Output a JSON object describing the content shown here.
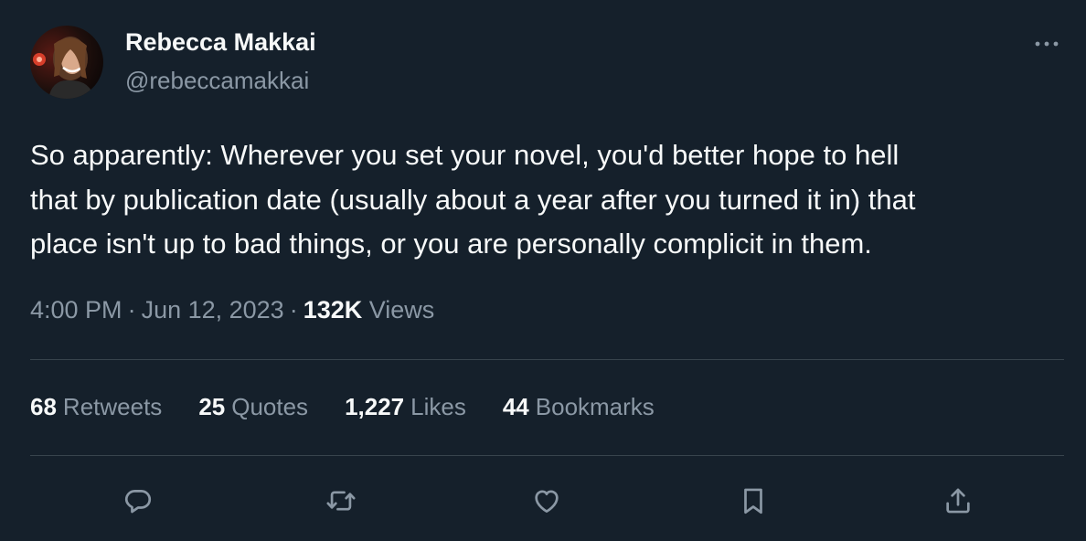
{
  "author": {
    "name": "Rebecca Makkai",
    "handle": "@rebeccamakkai"
  },
  "tweet": {
    "text": "So apparently: Wherever you set your novel, you'd better hope to hell\nthat by publication date (usually about a year after you turned it in) that\nplace isn't up to bad things, or you are personally complicit in them.",
    "time": "4:00 PM",
    "separator": "·",
    "date": "Jun 12, 2023",
    "views_count": "132K",
    "views_label": "Views"
  },
  "stats": [
    {
      "count": "68",
      "label": "Retweets"
    },
    {
      "count": "25",
      "label": "Quotes"
    },
    {
      "count": "1,227",
      "label": "Likes"
    },
    {
      "count": "44",
      "label": "Bookmarks"
    }
  ],
  "actions": {
    "reply": "reply-icon",
    "retweet": "retweet-icon",
    "like": "heart-icon",
    "bookmark": "bookmark-icon",
    "share": "share-icon"
  },
  "colors": {
    "background": "#15202b",
    "text": "#f7f9f9",
    "secondary_text": "#8b98a5",
    "divider": "#38444d"
  }
}
